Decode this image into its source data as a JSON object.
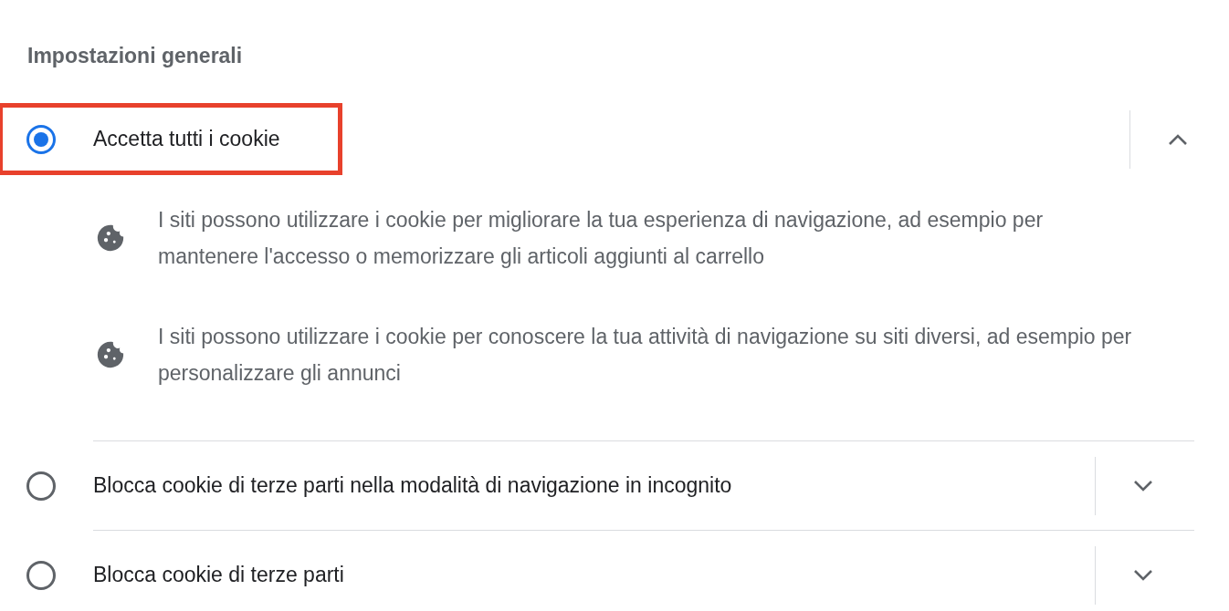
{
  "section_title": "Impostazioni generali",
  "options": [
    {
      "label": "Accetta tutti i cookie",
      "selected": true,
      "expanded": true,
      "highlighted": true,
      "details": [
        "I siti possono utilizzare i cookie per migliorare la tua esperienza di navigazione, ad esempio per mantenere l'accesso o memorizzare gli articoli aggiunti al carrello",
        "I siti possono utilizzare i cookie per conoscere la tua attività di navigazione su siti diversi, ad esempio per personalizzare gli annunci"
      ]
    },
    {
      "label": "Blocca cookie di terze parti nella modalità di navigazione in incognito",
      "selected": false,
      "expanded": false,
      "highlighted": false
    },
    {
      "label": "Blocca cookie di terze parti",
      "selected": false,
      "expanded": false,
      "highlighted": false
    }
  ]
}
